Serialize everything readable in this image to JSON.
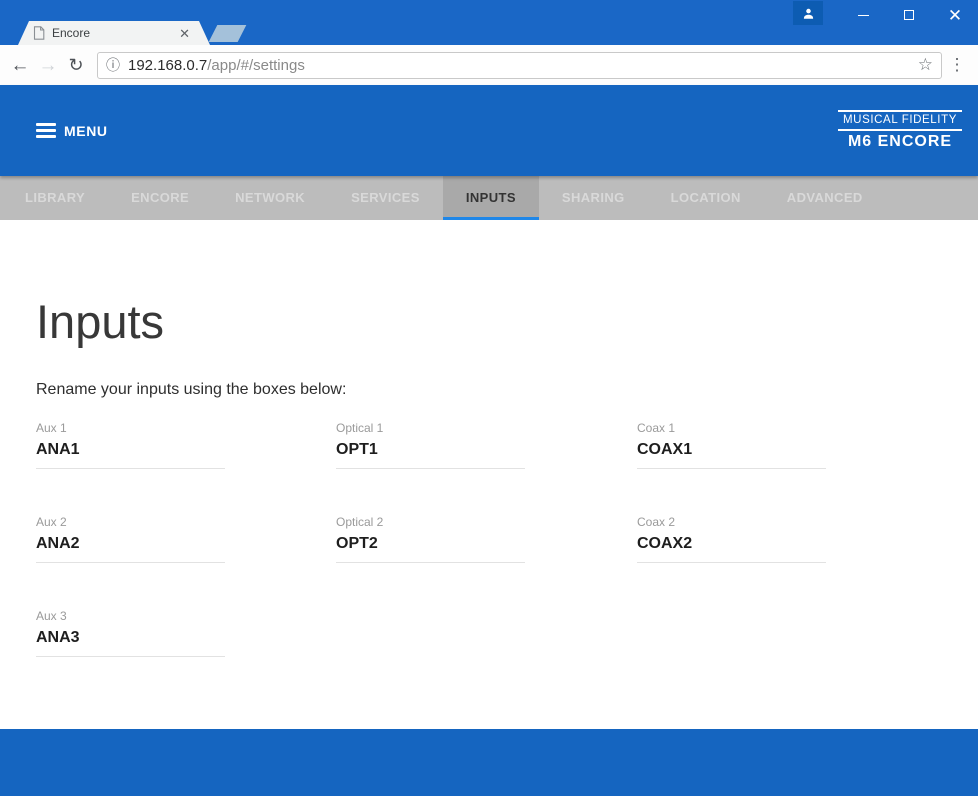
{
  "browser": {
    "tab_title": "Encore",
    "url": {
      "host": "192.168.0.7",
      "path": "/app/#/settings"
    }
  },
  "header": {
    "menu_label": "MENU",
    "logo_line1": "MUSICAL FIDELITY",
    "logo_line2": "M6 ENCORE"
  },
  "nav": {
    "active_tab": "INPUTS",
    "tabs": [
      {
        "label": "LIBRARY"
      },
      {
        "label": "ENCORE"
      },
      {
        "label": "NETWORK"
      },
      {
        "label": "SERVICES"
      },
      {
        "label": "INPUTS"
      },
      {
        "label": "SHARING"
      },
      {
        "label": "LOCATION"
      },
      {
        "label": "ADVANCED"
      }
    ]
  },
  "main": {
    "title": "Inputs",
    "subtitle": "Rename your inputs using the boxes below:",
    "fields": [
      {
        "label": "Aux 1",
        "value": "ANA1"
      },
      {
        "label": "Optical 1",
        "value": "OPT1"
      },
      {
        "label": "Coax 1",
        "value": "COAX1"
      },
      {
        "label": "Aux 2",
        "value": "ANA2"
      },
      {
        "label": "Optical 2",
        "value": "OPT2"
      },
      {
        "label": "Coax 2",
        "value": "COAX2"
      },
      {
        "label": "Aux 3",
        "value": "ANA3"
      }
    ]
  },
  "colors": {
    "accent_blue": "#1565c0",
    "titlebar_blue": "#1a67c6",
    "tab_underline_blue": "#1f87e8",
    "nav_bg": "#bcbcbc",
    "nav_active_bg": "#a9a9a9"
  }
}
